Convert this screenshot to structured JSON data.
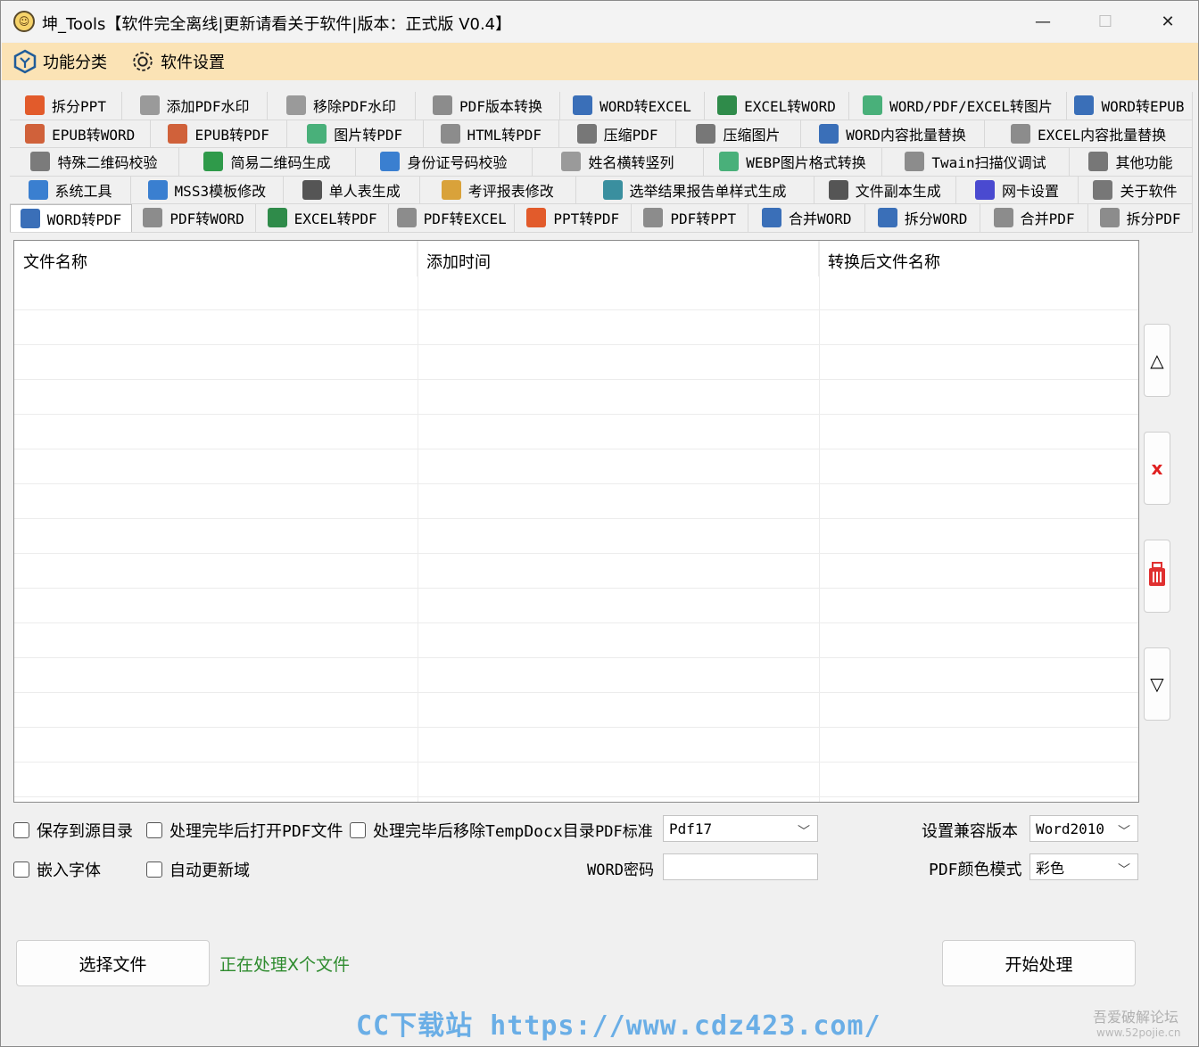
{
  "window": {
    "title": "坤_Tools【软件完全离线|更新请看关于软件|版本：正式版 V0.4】",
    "minimize": "—",
    "maximize": "☐",
    "close": "✕"
  },
  "menu": {
    "items": [
      {
        "label": "功能分类",
        "icon": "category-hexagon-icon"
      },
      {
        "label": "软件设置",
        "icon": "gear-icon"
      }
    ]
  },
  "tabs": {
    "rows": [
      [
        {
          "label": "拆分PPT",
          "icon": "ppt-icon",
          "color": "#e25b2b",
          "w": 126
        },
        {
          "label": "添加PDF水印",
          "icon": "watermark-icon",
          "color": "#9a9a9a",
          "w": 163
        },
        {
          "label": "移除PDF水印",
          "icon": "watermark-icon",
          "color": "#9a9a9a",
          "w": 166
        },
        {
          "label": "PDF版本转换",
          "icon": "pdf-icon",
          "color": "#8c8c8c",
          "w": 162
        },
        {
          "label": "WORD转EXCEL",
          "icon": "word-icon",
          "color": "#3a6fb8",
          "w": 162
        },
        {
          "label": "EXCEL转WORD",
          "icon": "excel-icon",
          "color": "#2f8b4a",
          "w": 162
        },
        {
          "label": "WORD/PDF/EXCEL转图片",
          "icon": "image-icon",
          "color": "#49b07a",
          "w": 244
        },
        {
          "label": "WORD转EPUB",
          "icon": "word-icon",
          "color": "#3a6fb8",
          "w": 141
        }
      ],
      [
        {
          "label": "EPUB转WORD",
          "icon": "epub-icon",
          "color": "#d0613a",
          "w": 162
        },
        {
          "label": "EPUB转PDF",
          "icon": "epub-icon",
          "color": "#d0613a",
          "w": 156
        },
        {
          "label": "图片转PDF",
          "icon": "image-icon",
          "color": "#49b07a",
          "w": 156
        },
        {
          "label": "HTML转PDF",
          "icon": "pdf-icon",
          "color": "#8c8c8c",
          "w": 156
        },
        {
          "label": "压缩PDF",
          "icon": "compress-icon",
          "color": "#777777",
          "w": 134
        },
        {
          "label": "压缩图片",
          "icon": "compress-icon",
          "color": "#777777",
          "w": 143
        },
        {
          "label": "WORD内容批量替换",
          "icon": "word-icon",
          "color": "#3a6fb8",
          "w": 211
        },
        {
          "label": "EXCEL内容批量替换",
          "icon": "excel-icon",
          "color": "#8c8c8c",
          "w": 238
        }
      ],
      [
        {
          "label": "特殊二维码校验",
          "icon": "qr-icon",
          "color": "#7b7b7b",
          "w": 190
        },
        {
          "label": "简易二维码生成",
          "icon": "qr-icon",
          "color": "#2f9a4a",
          "w": 198
        },
        {
          "label": "身份证号码校验",
          "icon": "id-card-icon",
          "color": "#3a7fd0",
          "w": 198
        },
        {
          "label": "姓名横转竖列",
          "icon": "name-list-icon",
          "color": "#9a9a9a",
          "w": 192
        },
        {
          "label": "WEBP图片格式转换",
          "icon": "image-icon",
          "color": "#49b07a",
          "w": 200
        },
        {
          "label": "Twain扫描仪调试",
          "icon": "scanner-icon",
          "color": "#8c8c8c",
          "w": 210
        },
        {
          "label": "其他功能",
          "icon": "more-icon",
          "color": "#777777",
          "w": 138
        }
      ],
      [
        {
          "label": "系统工具",
          "icon": "gear-icon",
          "color": "#3a7fd0",
          "w": 134
        },
        {
          "label": "MSS3模板修改",
          "icon": "gear-icon",
          "color": "#3a7fd0",
          "w": 168
        },
        {
          "label": "单人表生成",
          "icon": "document-icon",
          "color": "#555555",
          "w": 151
        },
        {
          "label": "考评报表修改",
          "icon": "report-icon",
          "color": "#d9a23a",
          "w": 172
        },
        {
          "label": "选举结果报告单样式生成",
          "icon": "notebook-icon",
          "color": "#3a8f9f",
          "w": 263
        },
        {
          "label": "文件副本生成",
          "icon": "file-copy-icon",
          "color": "#555555",
          "w": 157
        },
        {
          "label": "网卡设置",
          "icon": "network-icon",
          "color": "#4a4ad0",
          "w": 135
        },
        {
          "label": "关于软件",
          "icon": "info-icon",
          "color": "#777777",
          "w": 126
        }
      ],
      [
        {
          "label": "WORD转PDF",
          "icon": "word-icon",
          "color": "#3a6fb8",
          "w": 136,
          "active": true
        },
        {
          "label": "PDF转WORD",
          "icon": "pdf-icon",
          "color": "#8c8c8c",
          "w": 138
        },
        {
          "label": "EXCEL转PDF",
          "icon": "excel-icon",
          "color": "#2f8b4a",
          "w": 148
        },
        {
          "label": "PDF转EXCEL",
          "icon": "pdf-icon",
          "color": "#8c8c8c",
          "w": 140
        },
        {
          "label": "PPT转PDF",
          "icon": "ppt-icon",
          "color": "#e25b2b",
          "w": 130
        },
        {
          "label": "PDF转PPT",
          "icon": "pdf-icon",
          "color": "#8c8c8c",
          "w": 130
        },
        {
          "label": "合并WORD",
          "icon": "word-icon",
          "color": "#3a6fb8",
          "w": 130
        },
        {
          "label": "拆分WORD",
          "icon": "word-icon",
          "color": "#3a6fb8",
          "w": 128
        },
        {
          "label": "合并PDF",
          "icon": "pdf-icon",
          "color": "#8c8c8c",
          "w": 120
        },
        {
          "label": "拆分PDF",
          "icon": "pdf-icon",
          "color": "#8c8c8c",
          "w": 116
        }
      ]
    ]
  },
  "grid": {
    "columns": [
      "文件名称",
      "添加时间",
      "转换后文件名称"
    ]
  },
  "side_buttons": {
    "up": "△",
    "delete": "x",
    "clear": "clear-trash-icon",
    "down": "▽"
  },
  "options": {
    "save_to_source": "保存到源目录",
    "open_after": "处理完毕后打开PDF文件",
    "remove_temp": "处理完毕后移除TempDocx目录",
    "embed_fonts": "嵌入字体",
    "auto_update": "自动更新域",
    "pdf_standard_label": "PDF标准",
    "pdf_standard_value": "Pdf17",
    "word_password_label": "WORD密码",
    "compat_label": "设置兼容版本",
    "compat_value": "Word2010",
    "color_mode_label": "PDF颜色模式",
    "color_mode_value": "彩色"
  },
  "actions": {
    "select_file": "选择文件",
    "status": "正在处理X个文件",
    "start": "开始处理"
  },
  "watermarks": {
    "main": "CC下载站 https://www.cdz423.com/",
    "forum": "吾爱破解论坛",
    "forum_url": "www.52pojie.cn"
  }
}
